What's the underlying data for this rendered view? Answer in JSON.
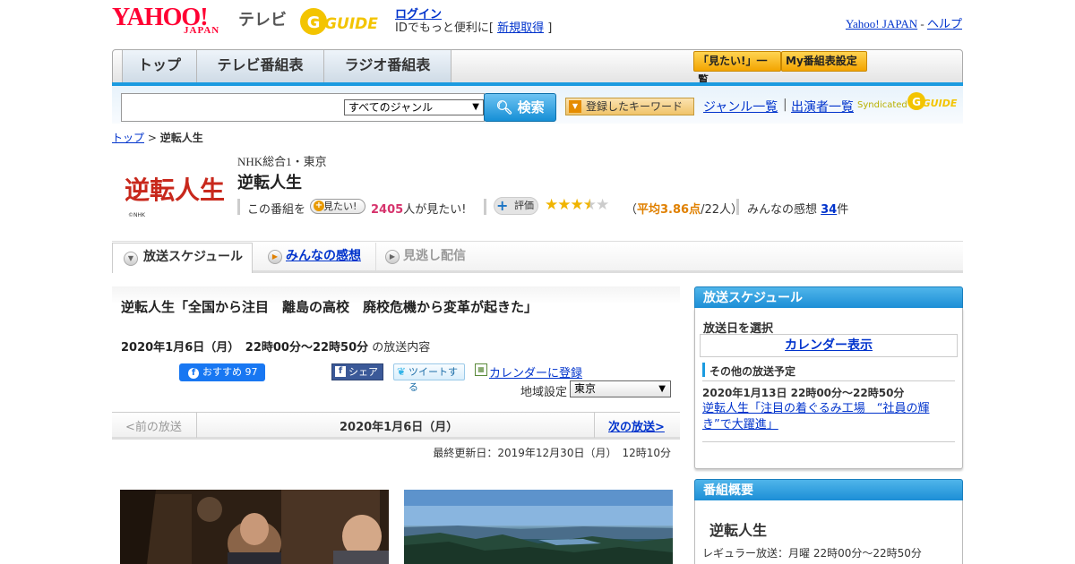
{
  "header": {
    "yahoo_logo": "YAHOO!",
    "yahoo_logo_sub": "JAPAN",
    "tv_label": "テレビ",
    "gguide_logo": "G GUIDE",
    "login": "ログイン",
    "login_prefix": "IDでもっと便利に[ ",
    "signup": "新規取得",
    "login_suffix": " ]",
    "yahoo_japan_link": "Yahoo! JAPAN",
    "separator": " - ",
    "help_link": "ヘルプ"
  },
  "nav": {
    "tabs": [
      {
        "label": "トップ"
      },
      {
        "label": "テレビ番組表"
      },
      {
        "label": "ラジオ番組表"
      }
    ],
    "mitai_list": "「見たい!」一覧",
    "my_guide": "My番組表設定"
  },
  "search": {
    "placeholder": "",
    "genre_selected": "すべてのジャンル",
    "button": "検索",
    "keyword_button": "登録したキーワード",
    "genre_list": "ジャンル一覧",
    "separator": "|",
    "performer_list": "出演者一覧",
    "syndicated": "Syndicated"
  },
  "breadcrumb": {
    "top": "トップ",
    "separator": " > ",
    "current": "逆転人生"
  },
  "program": {
    "logo_text": "逆転人生",
    "logo_credit": "©NHK",
    "channel": "NHK総合1・東京",
    "title": "逆転人生",
    "mitai_prefix": "この番組を",
    "mitai_button": "見たい!",
    "mitai_count": "2405",
    "mitai_suffix": "人が見たい!",
    "hyoka_button": "評価",
    "rating_value": 3.86,
    "rating_open": "（",
    "rating_avg": "平均3.86点",
    "rating_count": "/22人）",
    "kanso_label": "みんなの感想 ",
    "kanso_count": "34",
    "kanso_unit": "件"
  },
  "subtabs": {
    "schedule": "放送スケジュール",
    "kanso": "みんなの感想",
    "minogashi": "見逃し配信"
  },
  "episode": {
    "title": "逆転人生「全国から注目　離島の高校　廃校危機から変革が起きた」",
    "date": "2020年1月6日（月）　22時00分～22時50分",
    "date_suffix": "の放送内容",
    "fb_label": "おすすめ 97",
    "share_label": "シェア",
    "tweet_label": "ツイートする",
    "calendar_register": "カレンダーに登録",
    "region_label": "地域設定",
    "region_selected": "東京"
  },
  "pager": {
    "prev": "<前の放送",
    "current_date": "2020年1月6日（月）",
    "next": "次の放送>"
  },
  "updated": "最終更新日：2019年12月30日（月）　12時10分",
  "sidebar": {
    "schedule_head": "放送スケジュール",
    "select_date": "放送日を選択",
    "calendar": "カレンダー表示",
    "other_schedule": "その他の放送予定",
    "next_date": "2020年1月13日  22時00分～22時50分",
    "next_title": "逆転人生「注目の着ぐるみ工場　“社員の輝き”で大躍進」",
    "summary_head": "番組概要",
    "summary_title": "逆転人生",
    "summary_regular": "レギュラー放送：月曜 22時00分～22時50分"
  },
  "colors": {
    "brand_red": "#ff0033",
    "accent_blue": "#1b9be0",
    "link_blue": "#0033cc",
    "mitai_pink": "#d6336c",
    "rating_orange": "#e08000"
  }
}
